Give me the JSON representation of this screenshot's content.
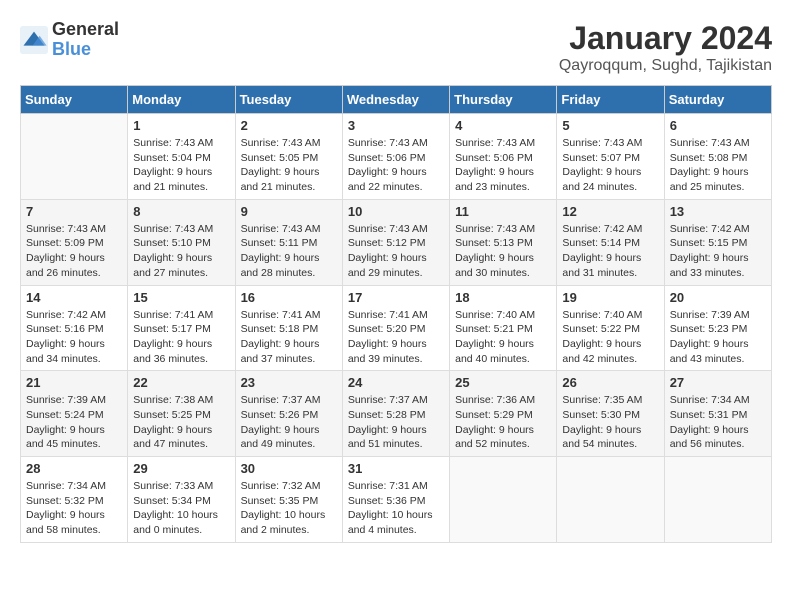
{
  "header": {
    "logo_line1": "General",
    "logo_line2": "Blue",
    "month_year": "January 2024",
    "location": "Qayroqqum, Sughd, Tajikistan"
  },
  "days_of_week": [
    "Sunday",
    "Monday",
    "Tuesday",
    "Wednesday",
    "Thursday",
    "Friday",
    "Saturday"
  ],
  "weeks": [
    [
      {
        "day": "",
        "info": ""
      },
      {
        "day": "1",
        "info": "Sunrise: 7:43 AM\nSunset: 5:04 PM\nDaylight: 9 hours\nand 21 minutes."
      },
      {
        "day": "2",
        "info": "Sunrise: 7:43 AM\nSunset: 5:05 PM\nDaylight: 9 hours\nand 21 minutes."
      },
      {
        "day": "3",
        "info": "Sunrise: 7:43 AM\nSunset: 5:06 PM\nDaylight: 9 hours\nand 22 minutes."
      },
      {
        "day": "4",
        "info": "Sunrise: 7:43 AM\nSunset: 5:06 PM\nDaylight: 9 hours\nand 23 minutes."
      },
      {
        "day": "5",
        "info": "Sunrise: 7:43 AM\nSunset: 5:07 PM\nDaylight: 9 hours\nand 24 minutes."
      },
      {
        "day": "6",
        "info": "Sunrise: 7:43 AM\nSunset: 5:08 PM\nDaylight: 9 hours\nand 25 minutes."
      }
    ],
    [
      {
        "day": "7",
        "info": "Sunrise: 7:43 AM\nSunset: 5:09 PM\nDaylight: 9 hours\nand 26 minutes."
      },
      {
        "day": "8",
        "info": "Sunrise: 7:43 AM\nSunset: 5:10 PM\nDaylight: 9 hours\nand 27 minutes."
      },
      {
        "day": "9",
        "info": "Sunrise: 7:43 AM\nSunset: 5:11 PM\nDaylight: 9 hours\nand 28 minutes."
      },
      {
        "day": "10",
        "info": "Sunrise: 7:43 AM\nSunset: 5:12 PM\nDaylight: 9 hours\nand 29 minutes."
      },
      {
        "day": "11",
        "info": "Sunrise: 7:43 AM\nSunset: 5:13 PM\nDaylight: 9 hours\nand 30 minutes."
      },
      {
        "day": "12",
        "info": "Sunrise: 7:42 AM\nSunset: 5:14 PM\nDaylight: 9 hours\nand 31 minutes."
      },
      {
        "day": "13",
        "info": "Sunrise: 7:42 AM\nSunset: 5:15 PM\nDaylight: 9 hours\nand 33 minutes."
      }
    ],
    [
      {
        "day": "14",
        "info": "Sunrise: 7:42 AM\nSunset: 5:16 PM\nDaylight: 9 hours\nand 34 minutes."
      },
      {
        "day": "15",
        "info": "Sunrise: 7:41 AM\nSunset: 5:17 PM\nDaylight: 9 hours\nand 36 minutes."
      },
      {
        "day": "16",
        "info": "Sunrise: 7:41 AM\nSunset: 5:18 PM\nDaylight: 9 hours\nand 37 minutes."
      },
      {
        "day": "17",
        "info": "Sunrise: 7:41 AM\nSunset: 5:20 PM\nDaylight: 9 hours\nand 39 minutes."
      },
      {
        "day": "18",
        "info": "Sunrise: 7:40 AM\nSunset: 5:21 PM\nDaylight: 9 hours\nand 40 minutes."
      },
      {
        "day": "19",
        "info": "Sunrise: 7:40 AM\nSunset: 5:22 PM\nDaylight: 9 hours\nand 42 minutes."
      },
      {
        "day": "20",
        "info": "Sunrise: 7:39 AM\nSunset: 5:23 PM\nDaylight: 9 hours\nand 43 minutes."
      }
    ],
    [
      {
        "day": "21",
        "info": "Sunrise: 7:39 AM\nSunset: 5:24 PM\nDaylight: 9 hours\nand 45 minutes."
      },
      {
        "day": "22",
        "info": "Sunrise: 7:38 AM\nSunset: 5:25 PM\nDaylight: 9 hours\nand 47 minutes."
      },
      {
        "day": "23",
        "info": "Sunrise: 7:37 AM\nSunset: 5:26 PM\nDaylight: 9 hours\nand 49 minutes."
      },
      {
        "day": "24",
        "info": "Sunrise: 7:37 AM\nSunset: 5:28 PM\nDaylight: 9 hours\nand 51 minutes."
      },
      {
        "day": "25",
        "info": "Sunrise: 7:36 AM\nSunset: 5:29 PM\nDaylight: 9 hours\nand 52 minutes."
      },
      {
        "day": "26",
        "info": "Sunrise: 7:35 AM\nSunset: 5:30 PM\nDaylight: 9 hours\nand 54 minutes."
      },
      {
        "day": "27",
        "info": "Sunrise: 7:34 AM\nSunset: 5:31 PM\nDaylight: 9 hours\nand 56 minutes."
      }
    ],
    [
      {
        "day": "28",
        "info": "Sunrise: 7:34 AM\nSunset: 5:32 PM\nDaylight: 9 hours\nand 58 minutes."
      },
      {
        "day": "29",
        "info": "Sunrise: 7:33 AM\nSunset: 5:34 PM\nDaylight: 10 hours\nand 0 minutes."
      },
      {
        "day": "30",
        "info": "Sunrise: 7:32 AM\nSunset: 5:35 PM\nDaylight: 10 hours\nand 2 minutes."
      },
      {
        "day": "31",
        "info": "Sunrise: 7:31 AM\nSunset: 5:36 PM\nDaylight: 10 hours\nand 4 minutes."
      },
      {
        "day": "",
        "info": ""
      },
      {
        "day": "",
        "info": ""
      },
      {
        "day": "",
        "info": ""
      }
    ]
  ]
}
